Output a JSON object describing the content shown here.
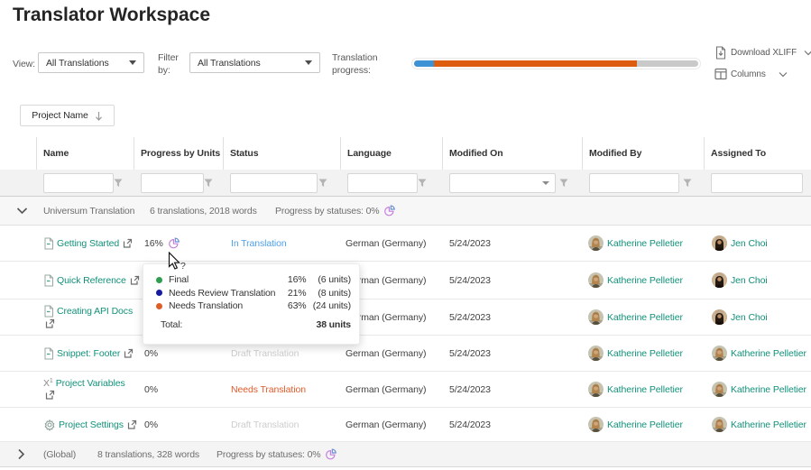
{
  "title": "Translator Workspace",
  "toolbar": {
    "view_label": "View:",
    "view_value": "All Translations",
    "filter_label_line1": "Filter",
    "filter_label_line2": "by:",
    "filter_value": "All Translations",
    "progress_label_line1": "Translation",
    "progress_label_line2": "progress:",
    "download_label": "Download XLIFF",
    "columns_label": "Columns"
  },
  "sort_chip": {
    "label": "Project Name"
  },
  "progress_bar": {
    "track_color": "#c9c9c9",
    "segments": [
      {
        "name": "final",
        "color": "#3c92d5",
        "percent": 7
      },
      {
        "name": "needs-translation",
        "color": "#dd5c10",
        "percent": 71.5
      }
    ]
  },
  "table": {
    "columns": {
      "name": "Name",
      "progress": "Progress by Units",
      "status": "Status",
      "language": "Language",
      "modified_on": "Modified On",
      "modified_by": "Modified By",
      "assigned_to": "Assigned To"
    },
    "groups": [
      {
        "name": "Universum Translation",
        "summary": "6 translations, 2018 words",
        "progress_label": "Progress by statuses: 0%",
        "expanded": true
      },
      {
        "name": "(Global)",
        "summary": "8 translations, 328 words",
        "progress_label": "Progress by statuses: 0%",
        "expanded": false
      }
    ],
    "rows": [
      {
        "name": "Getting Started",
        "progress": "16%",
        "status": "In Translation",
        "language": "German (Germany)",
        "modified_on": "5/24/2023",
        "modified_by": "Katherine Pelletier",
        "assigned_to": "Jen Choi"
      },
      {
        "name": "Quick Reference",
        "progress": "",
        "status": "",
        "language": "German (Germany)",
        "modified_on": "5/24/2023",
        "modified_by": "Katherine Pelletier",
        "assigned_to": "Jen Choi"
      },
      {
        "name": "Creating API Docs",
        "progress": "",
        "status": "",
        "language": "German (Germany)",
        "modified_on": "5/24/2023",
        "modified_by": "Katherine Pelletier",
        "assigned_to": "Jen Choi"
      },
      {
        "name": "Snippet: Footer",
        "progress": "0%",
        "status": "Draft Translation",
        "language": "German (Germany)",
        "modified_on": "5/24/2023",
        "modified_by": "Katherine Pelletier",
        "assigned_to": "Katherine Pelletier"
      },
      {
        "name": "Project Variables",
        "progress": "0%",
        "status": "Needs Translation",
        "language": "German (Germany)",
        "modified_on": "5/24/2023",
        "modified_by": "Katherine Pelletier",
        "assigned_to": "Katherine Pelletier"
      },
      {
        "name": "Project Settings",
        "progress": "0%",
        "status": "Draft Translation",
        "language": "German (Germany)",
        "modified_on": "5/24/2023",
        "modified_by": "Katherine Pelletier",
        "assigned_to": "Katherine Pelletier"
      }
    ]
  },
  "tooltip": {
    "items": [
      {
        "label": "Final",
        "percent": "16%",
        "units": "(6 units)",
        "color": "#2f9e4f"
      },
      {
        "label": "Needs Review Translation",
        "percent": "21%",
        "units": "(8 units)",
        "color": "#151a9e"
      },
      {
        "label": "Needs Translation",
        "percent": "63%",
        "units": "(24 units)",
        "color": "#dd5e28"
      }
    ],
    "total_label": "Total:",
    "total_value": "38 units"
  },
  "colors": {
    "link_green": "#12917a",
    "status_in_translation": "#4d9fe8",
    "status_draft": "#cdcdcd",
    "status_needs_translation": "#e25b2b",
    "bar_blue": "#3c92d5",
    "bar_orange": "#dd5c10",
    "pie_purple": "#c77fe0",
    "pie_blue": "#6b8fd4"
  }
}
